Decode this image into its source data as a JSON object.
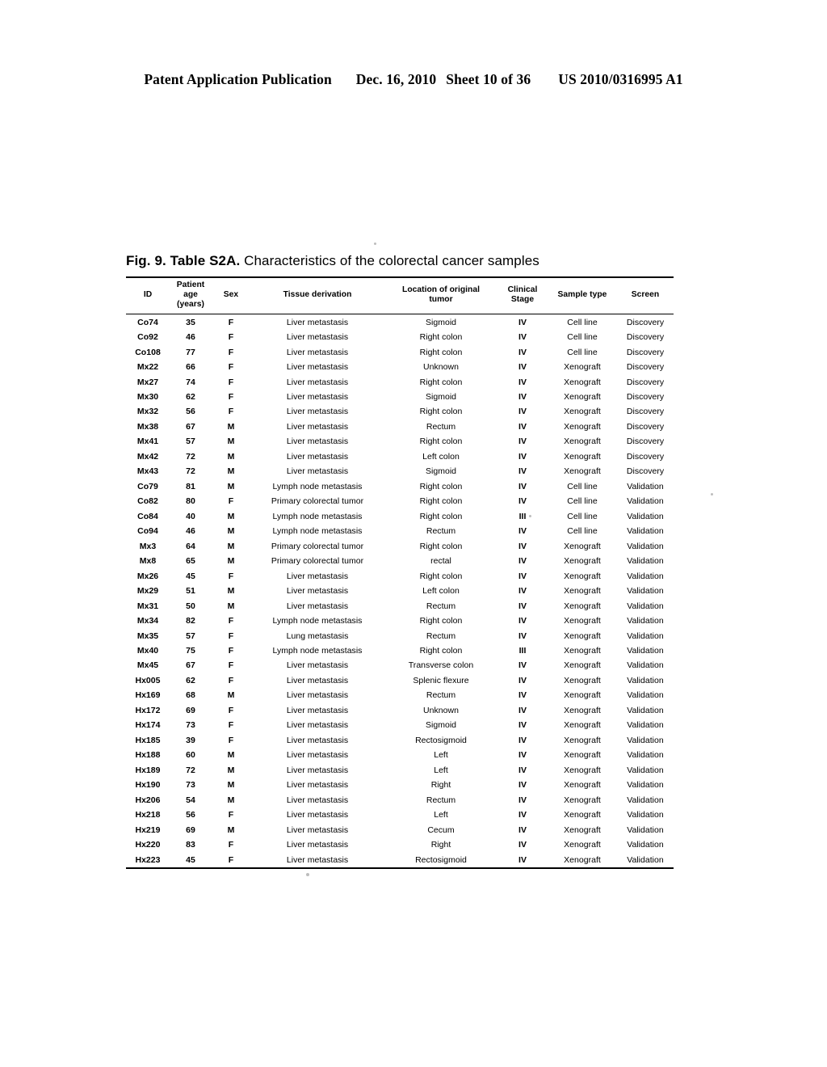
{
  "header": {
    "publication": "Patent Application Publication",
    "date": "Dec. 16, 2010",
    "sheet": "Sheet 10 of 36",
    "patent_number": "US 2010/0316995 A1"
  },
  "figure": {
    "label": "Fig. 9.  Table S2A.",
    "title": "Characteristics of the colorectal cancer samples"
  },
  "table": {
    "columns": [
      {
        "key": "id",
        "label": "ID"
      },
      {
        "key": "age",
        "label": "Patient age (years)",
        "line1": "Patient",
        "line2": "age",
        "line3": "(years)"
      },
      {
        "key": "sex",
        "label": "Sex"
      },
      {
        "key": "tissue",
        "label": "Tissue derivation"
      },
      {
        "key": "location",
        "label": "Location of original tumor",
        "line1": "Location of original",
        "line2": "tumor"
      },
      {
        "key": "stage",
        "label": "Clinical Stage",
        "line1": "Clinical",
        "line2": "Stage"
      },
      {
        "key": "sample_type",
        "label": "Sample type"
      },
      {
        "key": "screen",
        "label": "Screen"
      }
    ],
    "rows": [
      {
        "id": "Co74",
        "age": "35",
        "sex": "F",
        "tissue": "Liver metastasis",
        "location": "Sigmoid",
        "stage": "IV",
        "sample_type": "Cell line",
        "screen": "Discovery"
      },
      {
        "id": "Co92",
        "age": "46",
        "sex": "F",
        "tissue": "Liver metastasis",
        "location": "Right colon",
        "stage": "IV",
        "sample_type": "Cell line",
        "screen": "Discovery"
      },
      {
        "id": "Co108",
        "age": "77",
        "sex": "F",
        "tissue": "Liver metastasis",
        "location": "Right colon",
        "stage": "IV",
        "sample_type": "Cell line",
        "screen": "Discovery"
      },
      {
        "id": "Mx22",
        "age": "66",
        "sex": "F",
        "tissue": "Liver metastasis",
        "location": "Unknown",
        "stage": "IV",
        "sample_type": "Xenograft",
        "screen": "Discovery"
      },
      {
        "id": "Mx27",
        "age": "74",
        "sex": "F",
        "tissue": "Liver metastasis",
        "location": "Right colon",
        "stage": "IV",
        "sample_type": "Xenograft",
        "screen": "Discovery"
      },
      {
        "id": "Mx30",
        "age": "62",
        "sex": "F",
        "tissue": "Liver metastasis",
        "location": "Sigmoid",
        "stage": "IV",
        "sample_type": "Xenograft",
        "screen": "Discovery"
      },
      {
        "id": "Mx32",
        "age": "56",
        "sex": "F",
        "tissue": "Liver metastasis",
        "location": "Right colon",
        "stage": "IV",
        "sample_type": "Xenograft",
        "screen": "Discovery"
      },
      {
        "id": "Mx38",
        "age": "67",
        "sex": "M",
        "tissue": "Liver metastasis",
        "location": "Rectum",
        "stage": "IV",
        "sample_type": "Xenograft",
        "screen": "Discovery"
      },
      {
        "id": "Mx41",
        "age": "57",
        "sex": "M",
        "tissue": "Liver metastasis",
        "location": "Right colon",
        "stage": "IV",
        "sample_type": "Xenograft",
        "screen": "Discovery"
      },
      {
        "id": "Mx42",
        "age": "72",
        "sex": "M",
        "tissue": "Liver metastasis",
        "location": "Left colon",
        "stage": "IV",
        "sample_type": "Xenograft",
        "screen": "Discovery"
      },
      {
        "id": "Mx43",
        "age": "72",
        "sex": "M",
        "tissue": "Liver metastasis",
        "location": "Sigmoid",
        "stage": "IV",
        "sample_type": "Xenograft",
        "screen": "Discovery"
      },
      {
        "id": "Co79",
        "age": "81",
        "sex": "M",
        "tissue": "Lymph node metastasis",
        "location": "Right colon",
        "stage": "IV",
        "sample_type": "Cell line",
        "screen": "Validation"
      },
      {
        "id": "Co82",
        "age": "80",
        "sex": "F",
        "tissue": "Primary colorectal tumor",
        "location": "Right colon",
        "stage": "IV",
        "sample_type": "Cell line",
        "screen": "Validation"
      },
      {
        "id": "Co84",
        "age": "40",
        "sex": "M",
        "tissue": "Lymph node metastasis",
        "location": "Right colon",
        "stage": "III",
        "sample_type": "Cell line",
        "screen": "Validation"
      },
      {
        "id": "Co94",
        "age": "46",
        "sex": "M",
        "tissue": "Lymph node metastasis",
        "location": "Rectum",
        "stage": "IV",
        "sample_type": "Cell line",
        "screen": "Validation"
      },
      {
        "id": "Mx3",
        "age": "64",
        "sex": "M",
        "tissue": "Primary colorectal tumor",
        "location": "Right colon",
        "stage": "IV",
        "sample_type": "Xenograft",
        "screen": "Validation"
      },
      {
        "id": "Mx8",
        "age": "65",
        "sex": "M",
        "tissue": "Primary colorectal tumor",
        "location": "rectal",
        "stage": "IV",
        "sample_type": "Xenograft",
        "screen": "Validation"
      },
      {
        "id": "Mx26",
        "age": "45",
        "sex": "F",
        "tissue": "Liver metastasis",
        "location": "Right colon",
        "stage": "IV",
        "sample_type": "Xenograft",
        "screen": "Validation"
      },
      {
        "id": "Mx29",
        "age": "51",
        "sex": "M",
        "tissue": "Liver metastasis",
        "location": "Left colon",
        "stage": "IV",
        "sample_type": "Xenograft",
        "screen": "Validation"
      },
      {
        "id": "Mx31",
        "age": "50",
        "sex": "M",
        "tissue": "Liver metastasis",
        "location": "Rectum",
        "stage": "IV",
        "sample_type": "Xenograft",
        "screen": "Validation"
      },
      {
        "id": "Mx34",
        "age": "82",
        "sex": "F",
        "tissue": "Lymph node metastasis",
        "location": "Right colon",
        "stage": "IV",
        "sample_type": "Xenograft",
        "screen": "Validation"
      },
      {
        "id": "Mx35",
        "age": "57",
        "sex": "F",
        "tissue": "Lung metastasis",
        "location": "Rectum",
        "stage": "IV",
        "sample_type": "Xenograft",
        "screen": "Validation"
      },
      {
        "id": "Mx40",
        "age": "75",
        "sex": "F",
        "tissue": "Lymph node metastasis",
        "location": "Right colon",
        "stage": "III",
        "sample_type": "Xenograft",
        "screen": "Validation"
      },
      {
        "id": "Mx45",
        "age": "67",
        "sex": "F",
        "tissue": "Liver metastasis",
        "location": "Transverse colon",
        "stage": "IV",
        "sample_type": "Xenograft",
        "screen": "Validation"
      },
      {
        "id": "Hx005",
        "age": "62",
        "sex": "F",
        "tissue": "Liver metastasis",
        "location": "Splenic flexure",
        "stage": "IV",
        "sample_type": "Xenograft",
        "screen": "Validation"
      },
      {
        "id": "Hx169",
        "age": "68",
        "sex": "M",
        "tissue": "Liver metastasis",
        "location": "Rectum",
        "stage": "IV",
        "sample_type": "Xenograft",
        "screen": "Validation"
      },
      {
        "id": "Hx172",
        "age": "69",
        "sex": "F",
        "tissue": "Liver metastasis",
        "location": "Unknown",
        "stage": "IV",
        "sample_type": "Xenograft",
        "screen": "Validation"
      },
      {
        "id": "Hx174",
        "age": "73",
        "sex": "F",
        "tissue": "Liver metastasis",
        "location": "Sigmoid",
        "stage": "IV",
        "sample_type": "Xenograft",
        "screen": "Validation"
      },
      {
        "id": "Hx185",
        "age": "39",
        "sex": "F",
        "tissue": "Liver metastasis",
        "location": "Rectosigmoid",
        "stage": "IV",
        "sample_type": "Xenograft",
        "screen": "Validation"
      },
      {
        "id": "Hx188",
        "age": "60",
        "sex": "M",
        "tissue": "Liver metastasis",
        "location": "Left",
        "stage": "IV",
        "sample_type": "Xenograft",
        "screen": "Validation"
      },
      {
        "id": "Hx189",
        "age": "72",
        "sex": "M",
        "tissue": "Liver metastasis",
        "location": "Left",
        "stage": "IV",
        "sample_type": "Xenograft",
        "screen": "Validation"
      },
      {
        "id": "Hx190",
        "age": "73",
        "sex": "M",
        "tissue": "Liver metastasis",
        "location": "Right",
        "stage": "IV",
        "sample_type": "Xenograft",
        "screen": "Validation"
      },
      {
        "id": "Hx206",
        "age": "54",
        "sex": "M",
        "tissue": "Liver metastasis",
        "location": "Rectum",
        "stage": "IV",
        "sample_type": "Xenograft",
        "screen": "Validation"
      },
      {
        "id": "Hx218",
        "age": "56",
        "sex": "F",
        "tissue": "Liver metastasis",
        "location": "Left",
        "stage": "IV",
        "sample_type": "Xenograft",
        "screen": "Validation"
      },
      {
        "id": "Hx219",
        "age": "69",
        "sex": "M",
        "tissue": "Liver metastasis",
        "location": "Cecum",
        "stage": "IV",
        "sample_type": "Xenograft",
        "screen": "Validation"
      },
      {
        "id": "Hx220",
        "age": "83",
        "sex": "F",
        "tissue": "Liver metastasis",
        "location": "Right",
        "stage": "IV",
        "sample_type": "Xenograft",
        "screen": "Validation"
      },
      {
        "id": "Hx223",
        "age": "45",
        "sex": "F",
        "tissue": "Liver metastasis",
        "location": "Rectosigmoid",
        "stage": "IV",
        "sample_type": "Xenograft",
        "screen": "Validation"
      }
    ]
  }
}
